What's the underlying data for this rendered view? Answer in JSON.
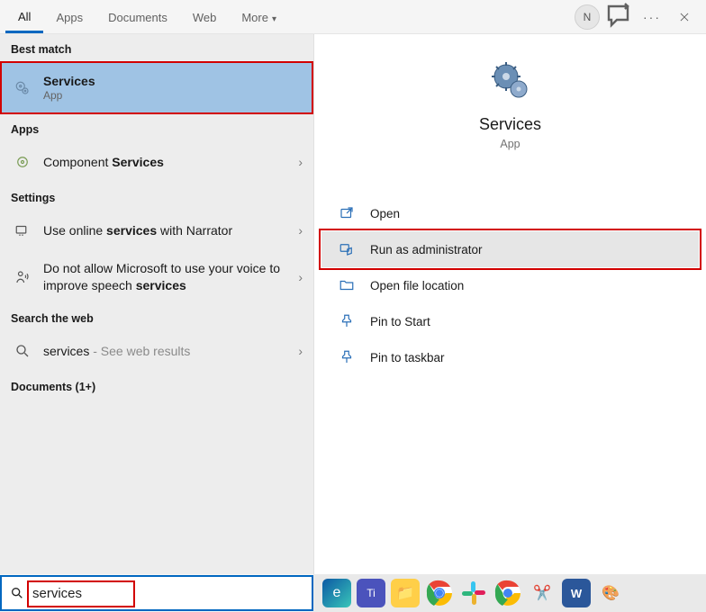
{
  "tabs": {
    "all": "All",
    "apps": "Apps",
    "documents": "Documents",
    "web": "Web",
    "more": "More"
  },
  "titlebar": {
    "avatar_initial": "N"
  },
  "left": {
    "best_match_h": "Best match",
    "best_match": {
      "title": "Services",
      "sub": "App"
    },
    "apps_h": "Apps",
    "apps_item": {
      "prefix": "Component ",
      "bold": "Services"
    },
    "settings_h": "Settings",
    "setting1": {
      "prefix": "Use online ",
      "bold": "services",
      "suffix": " with Narrator"
    },
    "setting2": {
      "prefix": "Do not allow Microsoft to use your voice to improve speech ",
      "bold": "services"
    },
    "web_h": "Search the web",
    "web_item": {
      "title": "services",
      "suffix": " - See web results"
    },
    "docs_h": "Documents (1+)"
  },
  "detail": {
    "title": "Services",
    "sub": "App",
    "actions": {
      "open": "Open",
      "runas": "Run as administrator",
      "openloc": "Open file location",
      "pinstart": "Pin to Start",
      "pintask": "Pin to taskbar"
    }
  },
  "search": {
    "value": "services"
  }
}
